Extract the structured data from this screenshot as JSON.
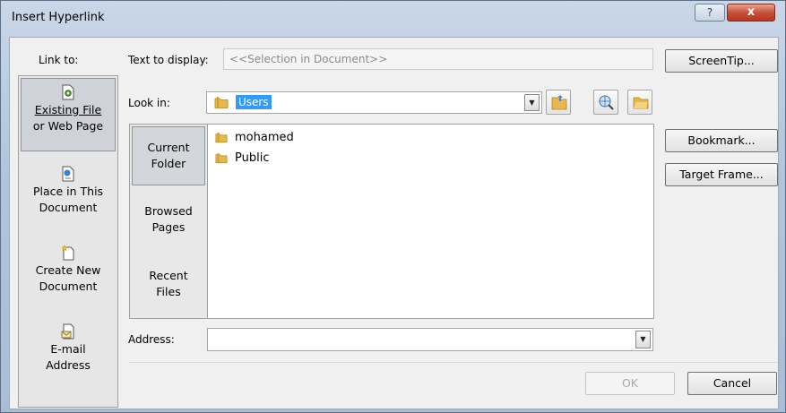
{
  "window": {
    "title": "Insert Hyperlink",
    "help_label": "?",
    "close_label": "x"
  },
  "link_to": {
    "label": "Link to:",
    "items": [
      {
        "line1": "Existing File",
        "line2": "or Web Page",
        "icon": "existing-file-icon"
      },
      {
        "line1": "Place in This",
        "line2": "Document",
        "icon": "document-place-icon"
      },
      {
        "line1": "Create New",
        "line2": "Document",
        "icon": "new-document-icon"
      },
      {
        "line1": "E-mail",
        "line2": "Address",
        "icon": "email-icon"
      }
    ]
  },
  "text_to_display": {
    "label": "Text to display:",
    "value": "<<Selection in Document>>"
  },
  "look_in": {
    "label": "Look in:",
    "value": "Users"
  },
  "places": [
    {
      "line1": "Current",
      "line2": "Folder"
    },
    {
      "line1": "Browsed",
      "line2": "Pages"
    },
    {
      "line1": "Recent",
      "line2": "Files"
    }
  ],
  "files": [
    {
      "name": "mohamed",
      "icon": "folder-icon"
    },
    {
      "name": "Public",
      "icon": "folder-icon"
    }
  ],
  "address": {
    "label": "Address:",
    "value": ""
  },
  "buttons": {
    "screentip": "ScreenTip...",
    "bookmark": "Bookmark...",
    "target_frame": "Target Frame...",
    "ok": "OK",
    "cancel": "Cancel"
  },
  "colors": {
    "selection": "#3399ff",
    "folder": "#e8b94a",
    "close": "#c7503b"
  }
}
